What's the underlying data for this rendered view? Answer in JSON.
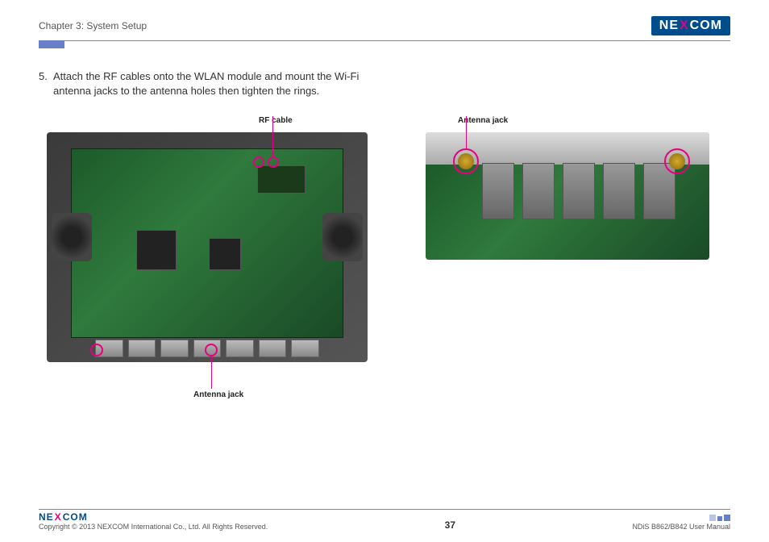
{
  "header": {
    "chapter": "Chapter 3: System Setup",
    "logo": {
      "pre": "NE",
      "mid": "X",
      "post": "COM"
    }
  },
  "step": {
    "number": "5.",
    "text": "Attach the RF cables onto the WLAN module and mount the Wi-Fi antenna jacks to the antenna holes then tighten the rings."
  },
  "labels": {
    "rf_cable": "RF cable",
    "antenna_jack_top": "Antenna jack",
    "antenna_jack_bottom": "Antenna jack"
  },
  "footer": {
    "logo": {
      "pre": "NE",
      "mid": "X",
      "post": "COM"
    },
    "copyright": "Copyright © 2013 NEXCOM International Co., Ltd. All Rights Reserved.",
    "page": "37",
    "manual": "NDiS B862/B842 User Manual"
  }
}
